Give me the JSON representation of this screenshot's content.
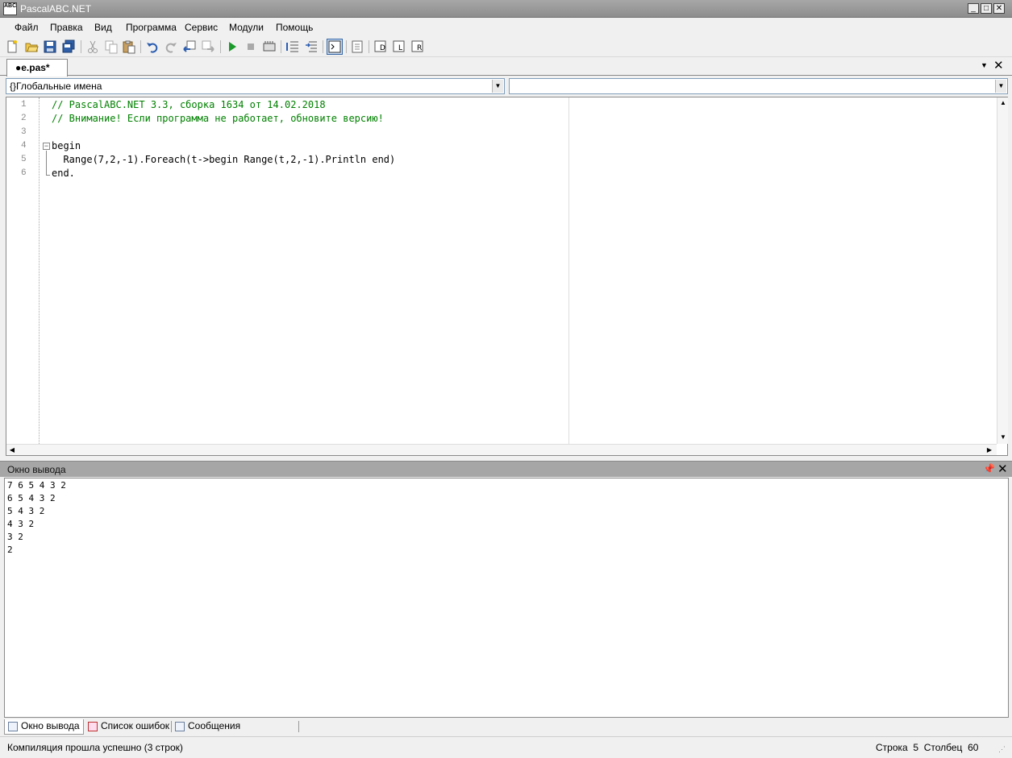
{
  "window": {
    "title": "PascalABC.NET",
    "icon_text": "ABC"
  },
  "menu": [
    {
      "label": "Файл"
    },
    {
      "label": "Правка"
    },
    {
      "label": "Вид"
    },
    {
      "label": "Программа"
    },
    {
      "label": "Сервис"
    },
    {
      "label": "Модули"
    },
    {
      "label": "Помощь"
    }
  ],
  "toolbar": {
    "icons": [
      "new-file-icon",
      "open-icon",
      "save-icon",
      "save-all-icon",
      "cut-icon",
      "copy-icon",
      "paste-icon",
      "undo-icon",
      "redo-icon",
      "navigate-back-icon",
      "navigate-forward-icon",
      "run-icon",
      "stop-icon",
      "compile-icon",
      "step-over-icon",
      "step-into-icon",
      "output-toggle-icon",
      "format-icon",
      "debug-window-icon",
      "watch-window-icon",
      "locals-window-icon"
    ]
  },
  "tab": {
    "label": "●e.pas*"
  },
  "combos": {
    "scope": "{}Глобальные имена",
    "member": ""
  },
  "editor": {
    "line_numbers": [
      "1",
      "2",
      "3",
      "4",
      "5",
      "6"
    ],
    "lines": [
      {
        "text": "// PascalABC.NET 3.3, сборка 1634 от 14.02.2018",
        "kind": "comment"
      },
      {
        "text": "// Внимание! Если программа не работает, обновите версию!",
        "kind": "comment"
      },
      {
        "text": "",
        "kind": "plain"
      },
      {
        "text": "begin",
        "kind": "plain"
      },
      {
        "text": "  Range(7,2,-1).Foreach(t->begin Range(t,2,-1).Println end)",
        "kind": "plain"
      },
      {
        "text": "end.",
        "kind": "plain"
      }
    ]
  },
  "output_panel": {
    "title": "Окно вывода",
    "lines": [
      "7 6 5 4 3 2",
      "6 5 4 3 2",
      "5 4 3 2",
      "4 3 2",
      "3 2",
      "2"
    ]
  },
  "bottom_tabs": [
    {
      "label": "Окно вывода"
    },
    {
      "label": "Список ошибок"
    },
    {
      "label": "Сообщения компилятора"
    }
  ],
  "status": {
    "message": "Компиляция прошла успешно (3 строк)",
    "position": "Строка  5  Столбец  60"
  }
}
